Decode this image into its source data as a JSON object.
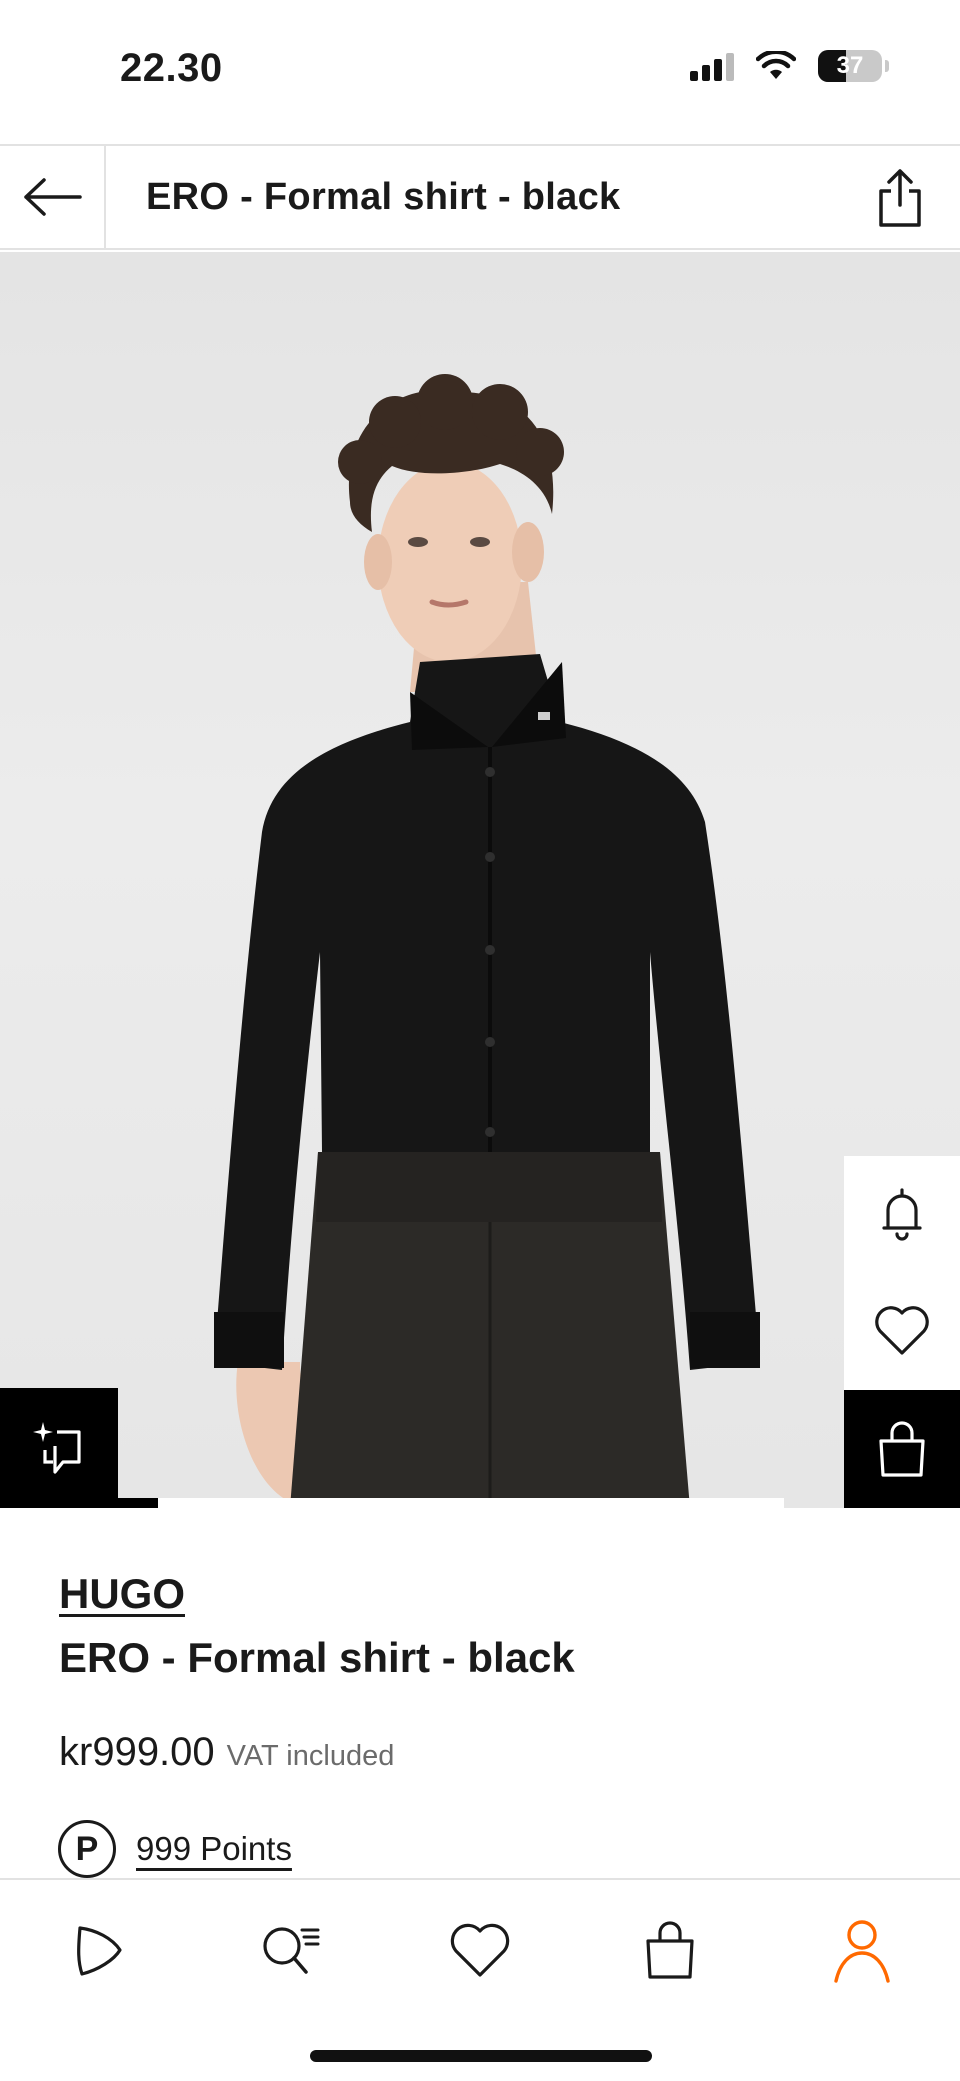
{
  "status_bar": {
    "time": "22.30",
    "battery": "37"
  },
  "header": {
    "title": "ERO - Formal shirt - black"
  },
  "product": {
    "brand": "HUGO",
    "name": "ERO - Formal shirt - black",
    "price": "kr999.00",
    "vat_note": "VAT included",
    "points": "999 Points",
    "points_icon_glyph": "P"
  },
  "image": {
    "carousel_index": 1
  },
  "icons": {
    "back": "arrow-left-icon",
    "share": "share-icon",
    "notify": "bell-icon",
    "wishlist": "heart-icon",
    "add_to_bag": "bag-icon",
    "find_similar": "sparkle-crop-icon"
  },
  "bottom_nav": {
    "items": [
      "home-icon",
      "search-icon",
      "wishlist-icon",
      "bag-icon",
      "profile-icon"
    ],
    "active": "profile-icon",
    "active_color": "#ff6900"
  }
}
